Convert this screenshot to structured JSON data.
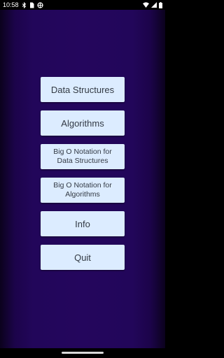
{
  "status_bar": {
    "time": "10:58",
    "icons": [
      "bluetooth-icon",
      "sim-card-icon",
      "settings-icon"
    ],
    "right_icons": [
      "wifi-icon",
      "signal-icon",
      "battery-icon"
    ]
  },
  "menu": {
    "items": [
      {
        "label": "Data Structures"
      },
      {
        "label": "Algorithms"
      },
      {
        "label": "Big O Notation for\nData Structures"
      },
      {
        "label": "Big O Notation for\nAlgorithms"
      },
      {
        "label": "Info"
      },
      {
        "label": "Quit"
      }
    ]
  },
  "colors": {
    "background": "#22065a",
    "button": "#dcecff",
    "button_text": "#333a44"
  }
}
